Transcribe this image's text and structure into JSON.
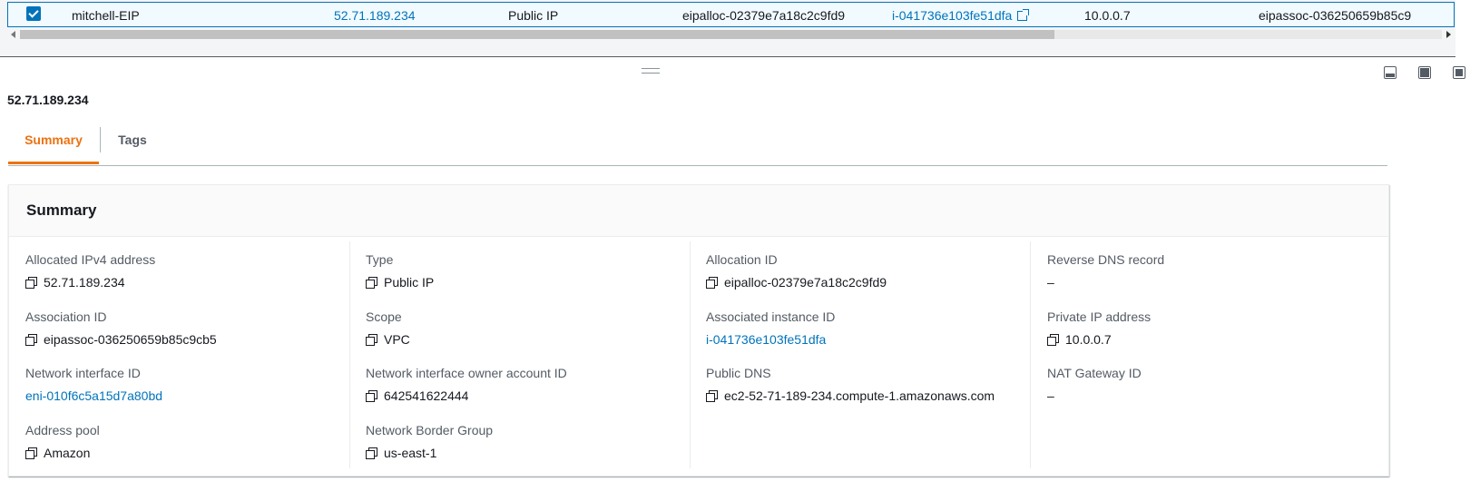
{
  "table": {
    "row": {
      "name": "mitchell-EIP",
      "ip": "52.71.189.234",
      "type": "Public IP",
      "allocation_id": "eipalloc-02379e7a18c2c9fd9",
      "instance_id": "i-041736e103fe51dfa",
      "private_ip": "10.0.0.7",
      "association_id": "eipassoc-036250659b85c9"
    }
  },
  "panel": {
    "title": "52.71.189.234",
    "tabs": [
      "Summary",
      "Tags"
    ]
  },
  "summary": {
    "heading": "Summary",
    "fields": {
      "allocated_ipv4": {
        "label": "Allocated IPv4 address",
        "value": "52.71.189.234"
      },
      "association_id": {
        "label": "Association ID",
        "value": "eipassoc-036250659b85c9cb5"
      },
      "network_interface_id": {
        "label": "Network interface ID",
        "value": "eni-010f6c5a15d7a80bd"
      },
      "address_pool": {
        "label": "Address pool",
        "value": "Amazon"
      },
      "type": {
        "label": "Type",
        "value": "Public IP"
      },
      "scope": {
        "label": "Scope",
        "value": "VPC"
      },
      "ni_owner": {
        "label": "Network interface owner account ID",
        "value": "642541622444"
      },
      "border_group": {
        "label": "Network Border Group",
        "value": "us-east-1"
      },
      "allocation_id": {
        "label": "Allocation ID",
        "value": "eipalloc-02379e7a18c2c9fd9"
      },
      "associated_instance": {
        "label": "Associated instance ID",
        "value": "i-041736e103fe51dfa"
      },
      "public_dns": {
        "label": "Public DNS",
        "value": "ec2-52-71-189-234.compute-1.amazonaws.com"
      },
      "reverse_dns": {
        "label": "Reverse DNS record",
        "value": "–"
      },
      "private_ip": {
        "label": "Private IP address",
        "value": "10.0.0.7"
      },
      "nat_gateway": {
        "label": "NAT Gateway ID",
        "value": "–"
      }
    }
  },
  "colors": {
    "link": "#0073bb",
    "active_tab": "#ec7211",
    "selected_row": "#f1faff"
  }
}
